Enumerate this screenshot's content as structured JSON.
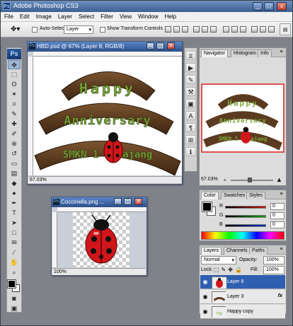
{
  "window": {
    "title": "Adobe Photoshop CS3",
    "logo": "Ps",
    "controls": {
      "minimize": "_",
      "maximize": "□",
      "close": "x"
    }
  },
  "menu": [
    "File",
    "Edit",
    "Image",
    "Layer",
    "Select",
    "Filter",
    "View",
    "Window",
    "Help"
  ],
  "options_bar": {
    "auto_select_label": "Auto-Select:",
    "auto_select_value": "Layer",
    "show_transform_label": "Show Transform Controls"
  },
  "toolbox": {
    "logo": "Ps",
    "tools": [
      "move-tool",
      "marquee-tool",
      "lasso-tool",
      "magic-wand-tool",
      "crop-tool",
      "slice-tool",
      "healing-brush-tool",
      "brush-tool",
      "clone-stamp-tool",
      "history-brush-tool",
      "eraser-tool",
      "gradient-tool",
      "blur-tool",
      "dodge-tool",
      "pen-tool",
      "type-tool",
      "path-selection-tool",
      "rectangle-tool",
      "notes-tool",
      "eyedropper-tool",
      "hand-tool",
      "zoom-tool"
    ],
    "tool_glyphs": [
      "✥",
      "⬚",
      "ʘ",
      "✶",
      "⌗",
      "✎",
      "✚",
      "✐",
      "⊕",
      "↺",
      "▭",
      "▤",
      "◆",
      "●",
      "✒",
      "T",
      "➤",
      "□",
      "✉",
      "⁄",
      "✋",
      "⌕"
    ],
    "foreground_color": "#000000",
    "background_color": "#ffffff"
  },
  "doc_main": {
    "title": "HBD.psd @ 67% (Layer 8, RGB/8)",
    "zoom": "67.03%",
    "art": {
      "line1": "Happy",
      "line2": "Anniversary",
      "line3": "SMKN 1 Lumajang"
    }
  },
  "doc_small": {
    "title": "Coccinella.png ...",
    "zoom": "100%"
  },
  "navigator": {
    "tabs": [
      "Navigator",
      "Histogram",
      "Info"
    ],
    "zoom": "67.03%"
  },
  "color_panel": {
    "tabs": [
      "Color",
      "Swatches",
      "Styles"
    ],
    "channels": [
      {
        "label": "R",
        "value": "0",
        "color": "#d01010"
      },
      {
        "label": "G",
        "value": "0",
        "color": "#10a010"
      },
      {
        "label": "B",
        "value": "0",
        "color": "#1030d0"
      }
    ]
  },
  "layers_panel": {
    "tabs": [
      "Layers",
      "Channels",
      "Paths"
    ],
    "blend_mode": "Normal",
    "opacity_label": "Opacity:",
    "opacity": "100%",
    "lock_label": "Lock:",
    "fill_label": "Fill:",
    "fill": "100%",
    "layers": [
      "Layer 8",
      "Layer 3",
      "Happy copy"
    ],
    "fx_label": "fx"
  },
  "colors": {
    "accent": "#2f5fb0",
    "wood": "#5b3b1f",
    "text_green": "#7da83a",
    "ladybug_red": "#d0161b"
  }
}
